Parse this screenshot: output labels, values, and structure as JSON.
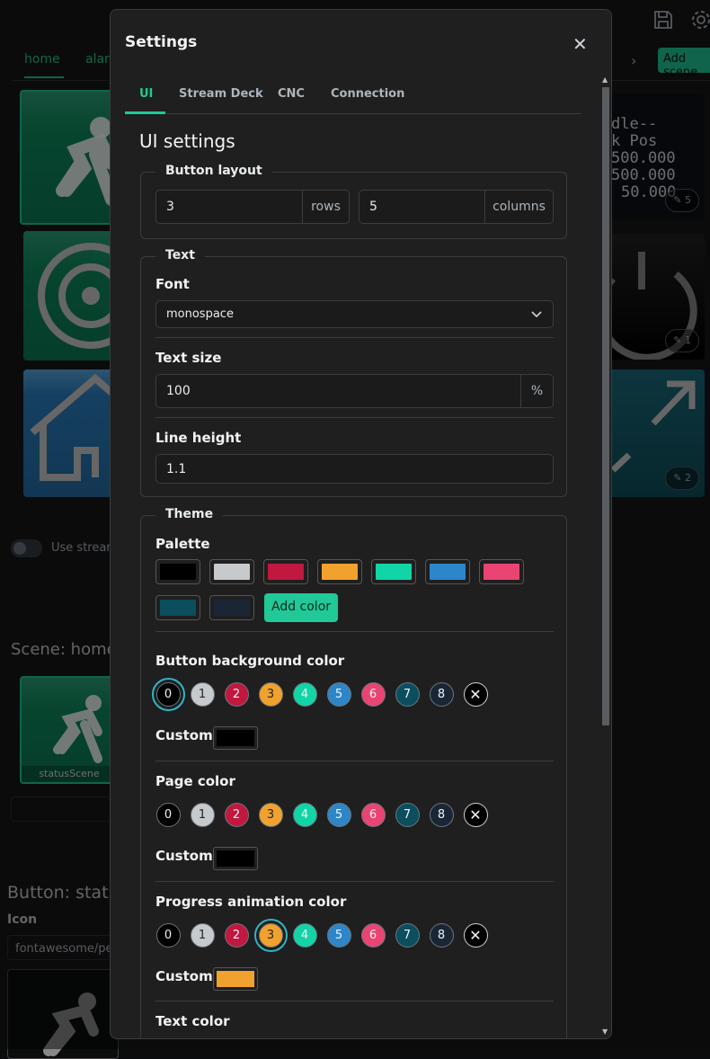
{
  "background": {
    "tabs": [
      "home",
      "alarm"
    ],
    "add_scene_label": "Add scene",
    "tile_text": [
      "dle--",
      "k Pos",
      "500.000",
      "500.000",
      "50.000"
    ],
    "badges": [
      "5",
      "1",
      "2"
    ],
    "toggle_label": "Use stream",
    "scene_title": "Scene: home",
    "scene_tile_caption": "statusScene",
    "button_title": "Button: statu",
    "icon_label": "Icon",
    "icon_value": "fontawesome/pers"
  },
  "modal": {
    "title": "Settings",
    "close_icon": "close-icon",
    "tabs": [
      "UI",
      "Stream Deck",
      "CNC",
      "Connection"
    ],
    "heading": "UI settings",
    "button_layout": {
      "legend": "Button layout",
      "rows_value": "3",
      "rows_unit": "rows",
      "columns_value": "5",
      "columns_unit": "columns"
    },
    "text": {
      "legend": "Text",
      "font_label": "Font",
      "font_value": "monospace",
      "text_size_label": "Text size",
      "text_size_value": "100",
      "text_size_unit": "%",
      "line_height_label": "Line height",
      "line_height_value": "1.1"
    },
    "theme": {
      "legend": "Theme",
      "palette_label": "Palette",
      "palette": [
        "#000000",
        "#c7cacd",
        "#c1183f",
        "#f1a12d",
        "#11d5a6",
        "#2c86c7",
        "#ea4472",
        "#0b4e5d",
        "#1a2635"
      ],
      "add_color_label": "Add color",
      "dot_labels": [
        "0",
        "1",
        "2",
        "3",
        "4",
        "5",
        "6",
        "7",
        "8"
      ],
      "button_bg_label": "Button background color",
      "button_bg_selected": "0",
      "button_bg_custom": "#000000",
      "page_color_label": "Page color",
      "page_color_custom": "#000000",
      "progress_label": "Progress animation color",
      "progress_selected": "3",
      "progress_custom": "#f1a12d",
      "custom_label": "Custom",
      "text_color_label": "Text color"
    }
  }
}
